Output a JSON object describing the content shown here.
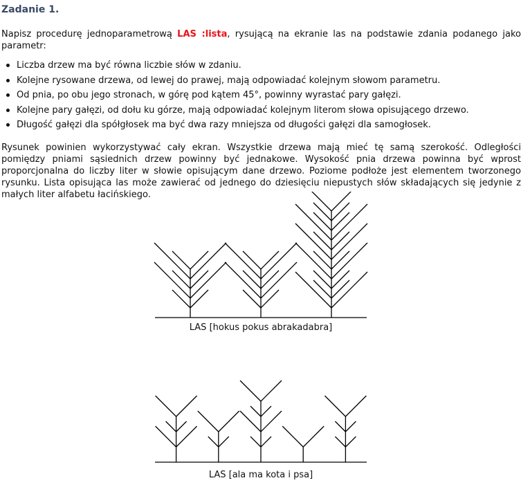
{
  "task": {
    "title": "Zadanie 1.",
    "intro_before": "Napisz procedurę jednoparametrową ",
    "keyword": "LAS :lista",
    "intro_after": ", rysującą na ekranie las na podstawie zdania podanego jako parametr:",
    "rules": [
      "Liczba drzew ma być równa liczbie słów w zdaniu.",
      "Kolejne rysowane drzewa, od lewej do prawej, mają odpowiadać kolejnym słowom parametru.",
      "Od pnia, po obu jego stronach, w górę pod kątem 45°, powinny wyrastać pary gałęzi.",
      "Kolejne pary gałęzi, od dołu ku górze, mają odpowiadać kolejnym literom słowa opisującego drzewo.",
      "Długość gałęzi dla spółgłosek ma być dwa razy mniejsza od długości gałęzi dla samogłosek."
    ],
    "description": "Rysunek powinien wykorzystywać cały ekran. Wszystkie drzewa mają mieć tę samą szerokość. Odległości pomiędzy pniami sąsiednich drzew powinny być jednakowe. Wysokość pnia drzewa powinna być wprost proporcjonalna do liczby liter w słowie opisującym dane drzewo. Poziome podłoże jest elementem tworzonego rysunku. Lista opisująca las może zawierać od jednego do dziesięciu niepustych słów składających się jedynie z małych liter alfabetu łacińskiego."
  },
  "figures": [
    {
      "caption": "LAS [hokus pokus abrakadabra]",
      "words": [
        "hokus",
        "pokus",
        "abrakadabra"
      ]
    },
    {
      "caption": "LAS [ala ma kota i psa]",
      "words": [
        "ala",
        "ma",
        "kota",
        "i",
        "psa"
      ]
    }
  ]
}
